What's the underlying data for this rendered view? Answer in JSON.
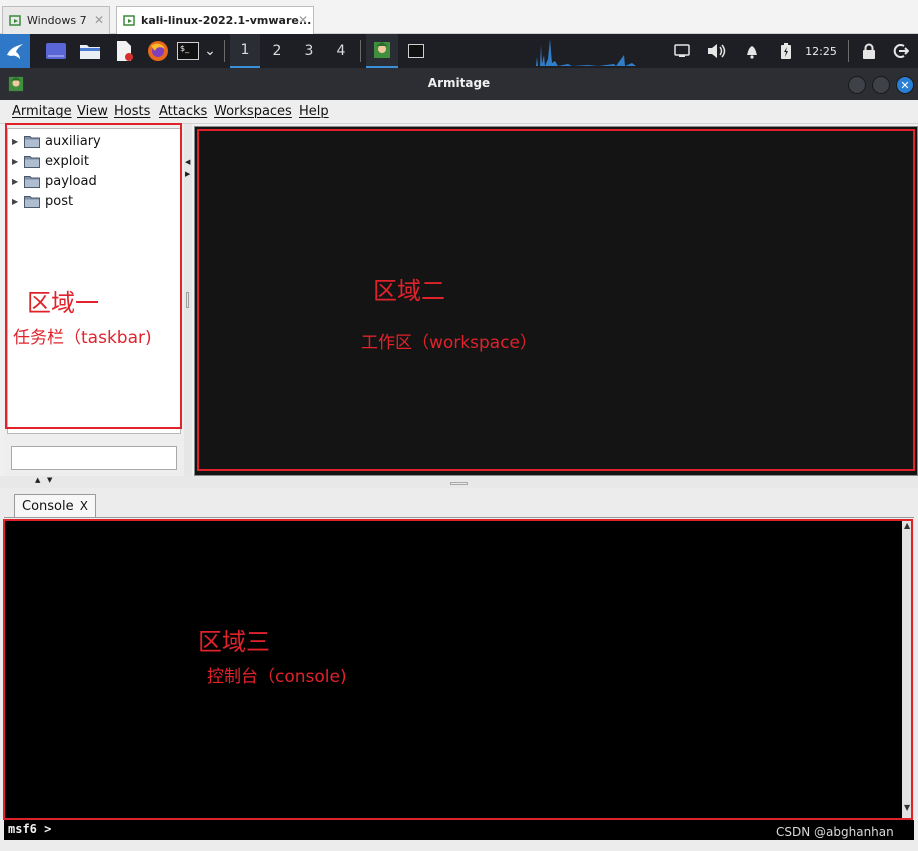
{
  "vmware": {
    "tabs": [
      {
        "label": "Windows 7",
        "close": "✕"
      },
      {
        "label": "kali-linux-2022.1-vmware...",
        "close": "✕"
      }
    ]
  },
  "kali_panel": {
    "workspaces": [
      "1",
      "2",
      "3",
      "4"
    ],
    "active_workspace": "1",
    "clock": "12:25",
    "terminal_glyph": "$_",
    "dropdown_glyph": "⌄"
  },
  "window": {
    "title": "Armitage",
    "close_glyph": "✕"
  },
  "menu": {
    "items": [
      "Armitage",
      "View",
      "Hosts",
      "Attacks",
      "Workspaces",
      "Help"
    ]
  },
  "tree": {
    "items": [
      "auxiliary",
      "exploit",
      "payload",
      "post"
    ],
    "expand_glyph": "▶"
  },
  "console": {
    "tab_label": "Console",
    "tab_close": "X",
    "prompt": "msf6 >"
  },
  "annotations": {
    "region1_title": "区域一",
    "region1_sub": "任务栏（taskbar)",
    "region2_title": "区域二",
    "region2_sub": "工作区（workspace）",
    "region3_title": "区域三",
    "region3_sub": "控制台（console)"
  },
  "watermark": "CSDN @abghanhan",
  "colors": {
    "annotation_red": "#e0222b",
    "panel_bg": "#1d1f24",
    "workspace_bg": "#141414",
    "console_bg": "#000000",
    "accent_blue": "#2a7fd4"
  }
}
